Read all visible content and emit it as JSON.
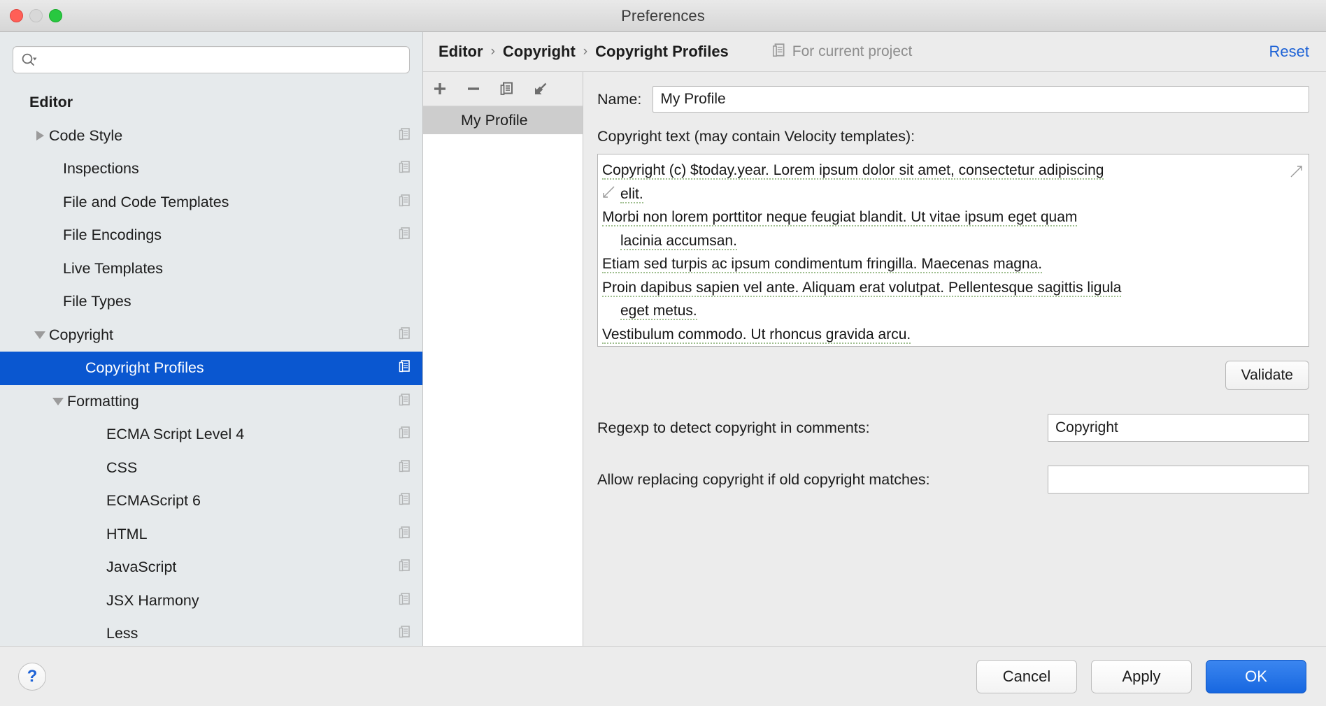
{
  "window": {
    "title": "Preferences",
    "traffic_lights": [
      "close",
      "minimize",
      "zoom"
    ]
  },
  "search": {
    "value": "",
    "placeholder": "",
    "icon": "search-icon"
  },
  "sidebar": {
    "items": [
      {
        "label": "Editor",
        "level": 0,
        "bold": true,
        "twisty": "none",
        "project_icon": false
      },
      {
        "label": "Code Style",
        "level": 1,
        "bold": false,
        "twisty": "collapsed",
        "project_icon": true
      },
      {
        "label": "Inspections",
        "level": 1,
        "bold": false,
        "twisty": "none",
        "project_icon": true
      },
      {
        "label": "File and Code Templates",
        "level": 1,
        "bold": false,
        "twisty": "none",
        "project_icon": true
      },
      {
        "label": "File Encodings",
        "level": 1,
        "bold": false,
        "twisty": "none",
        "project_icon": true
      },
      {
        "label": "Live Templates",
        "level": 1,
        "bold": false,
        "twisty": "none",
        "project_icon": false
      },
      {
        "label": "File Types",
        "level": 1,
        "bold": false,
        "twisty": "none",
        "project_icon": false
      },
      {
        "label": "Copyright",
        "level": 1,
        "bold": false,
        "twisty": "expanded",
        "project_icon": true
      },
      {
        "label": "Copyright Profiles",
        "level": 2,
        "bold": false,
        "twisty": "none",
        "project_icon": true,
        "selected": true
      },
      {
        "label": "Formatting",
        "level": 2,
        "bold": false,
        "twisty": "expanded",
        "project_icon": true
      },
      {
        "label": "ECMA Script Level 4",
        "level": 3,
        "bold": false,
        "twisty": "none",
        "project_icon": true
      },
      {
        "label": "CSS",
        "level": 3,
        "bold": false,
        "twisty": "none",
        "project_icon": true
      },
      {
        "label": "ECMAScript 6",
        "level": 3,
        "bold": false,
        "twisty": "none",
        "project_icon": true
      },
      {
        "label": "HTML",
        "level": 3,
        "bold": false,
        "twisty": "none",
        "project_icon": true
      },
      {
        "label": "JavaScript",
        "level": 3,
        "bold": false,
        "twisty": "none",
        "project_icon": true
      },
      {
        "label": "JSX Harmony",
        "level": 3,
        "bold": false,
        "twisty": "none",
        "project_icon": true
      },
      {
        "label": "Less",
        "level": 3,
        "bold": false,
        "twisty": "none",
        "project_icon": true
      }
    ]
  },
  "breadcrumb": {
    "parts": [
      "Editor",
      "Copyright",
      "Copyright Profiles"
    ],
    "separator": "›",
    "for_project_label": "For current project",
    "for_project_icon": "project-scope-icon",
    "reset_label": "Reset"
  },
  "profiles": {
    "toolbar": [
      {
        "name": "add-profile-button",
        "icon": "plus-icon"
      },
      {
        "name": "remove-profile-button",
        "icon": "minus-icon"
      },
      {
        "name": "copy-profile-button",
        "icon": "copy-icon"
      },
      {
        "name": "import-profile-button",
        "icon": "import-arrow-icon"
      }
    ],
    "items": [
      {
        "label": "My Profile",
        "selected": true
      }
    ]
  },
  "form": {
    "name_label": "Name:",
    "name_value": "My Profile",
    "copyright_text_label": "Copyright text (may contain Velocity templates):",
    "copyright_text_lines": [
      {
        "text": "Copyright (c) $today.year. Lorem ipsum dolor sit amet, consectetur adipiscing",
        "continuation": false
      },
      {
        "text": "elit.",
        "continuation": true
      },
      {
        "text": "Morbi non lorem porttitor neque feugiat blandit. Ut vitae ipsum eget quam",
        "continuation": false
      },
      {
        "text": "lacinia accumsan.",
        "continuation": true
      },
      {
        "text": "Etiam sed turpis ac ipsum condimentum fringilla. Maecenas magna.",
        "continuation": false
      },
      {
        "text": "Proin dapibus sapien vel ante. Aliquam erat volutpat. Pellentesque sagittis ligula",
        "continuation": false
      },
      {
        "text": "eget metus.",
        "continuation": true
      },
      {
        "text": "Vestibulum commodo. Ut rhoncus gravida arcu.",
        "continuation": false
      }
    ],
    "validate_label": "Validate",
    "regexp_label": "Regexp to detect copyright in comments:",
    "regexp_value": "Copyright",
    "allow_replace_label": "Allow replacing copyright if old copyright matches:",
    "allow_replace_value": ""
  },
  "footer": {
    "help_label": "?",
    "cancel_label": "Cancel",
    "apply_label": "Apply",
    "ok_label": "OK"
  },
  "colors": {
    "selection_blue": "#0a57d0",
    "primary_button": "#1767e0",
    "link_blue": "#1d62d6",
    "sidebar_bg": "#e6eaec",
    "panel_bg": "#ececec",
    "spellcheck_underline": "#9fbf8f"
  }
}
